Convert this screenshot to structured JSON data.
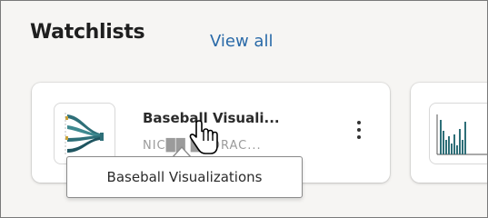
{
  "header": {
    "title": "Watchlists",
    "view_all_label": "View all"
  },
  "cards": [
    {
      "title": "Baseball Visuali...",
      "subtitle": "NIC██ ██ORAC...",
      "thumbnail_icon": "sankey-chart-icon",
      "menu_icon": "kebab-menu-icon"
    },
    {
      "thumbnail_icon": "bar-chart-icon"
    }
  ],
  "tooltip": {
    "text": "Baseball Visualizations"
  },
  "colors": {
    "link": "#2a6aa8",
    "chart_teal": "#2e6f78",
    "chart_gold": "#c9a23a"
  }
}
